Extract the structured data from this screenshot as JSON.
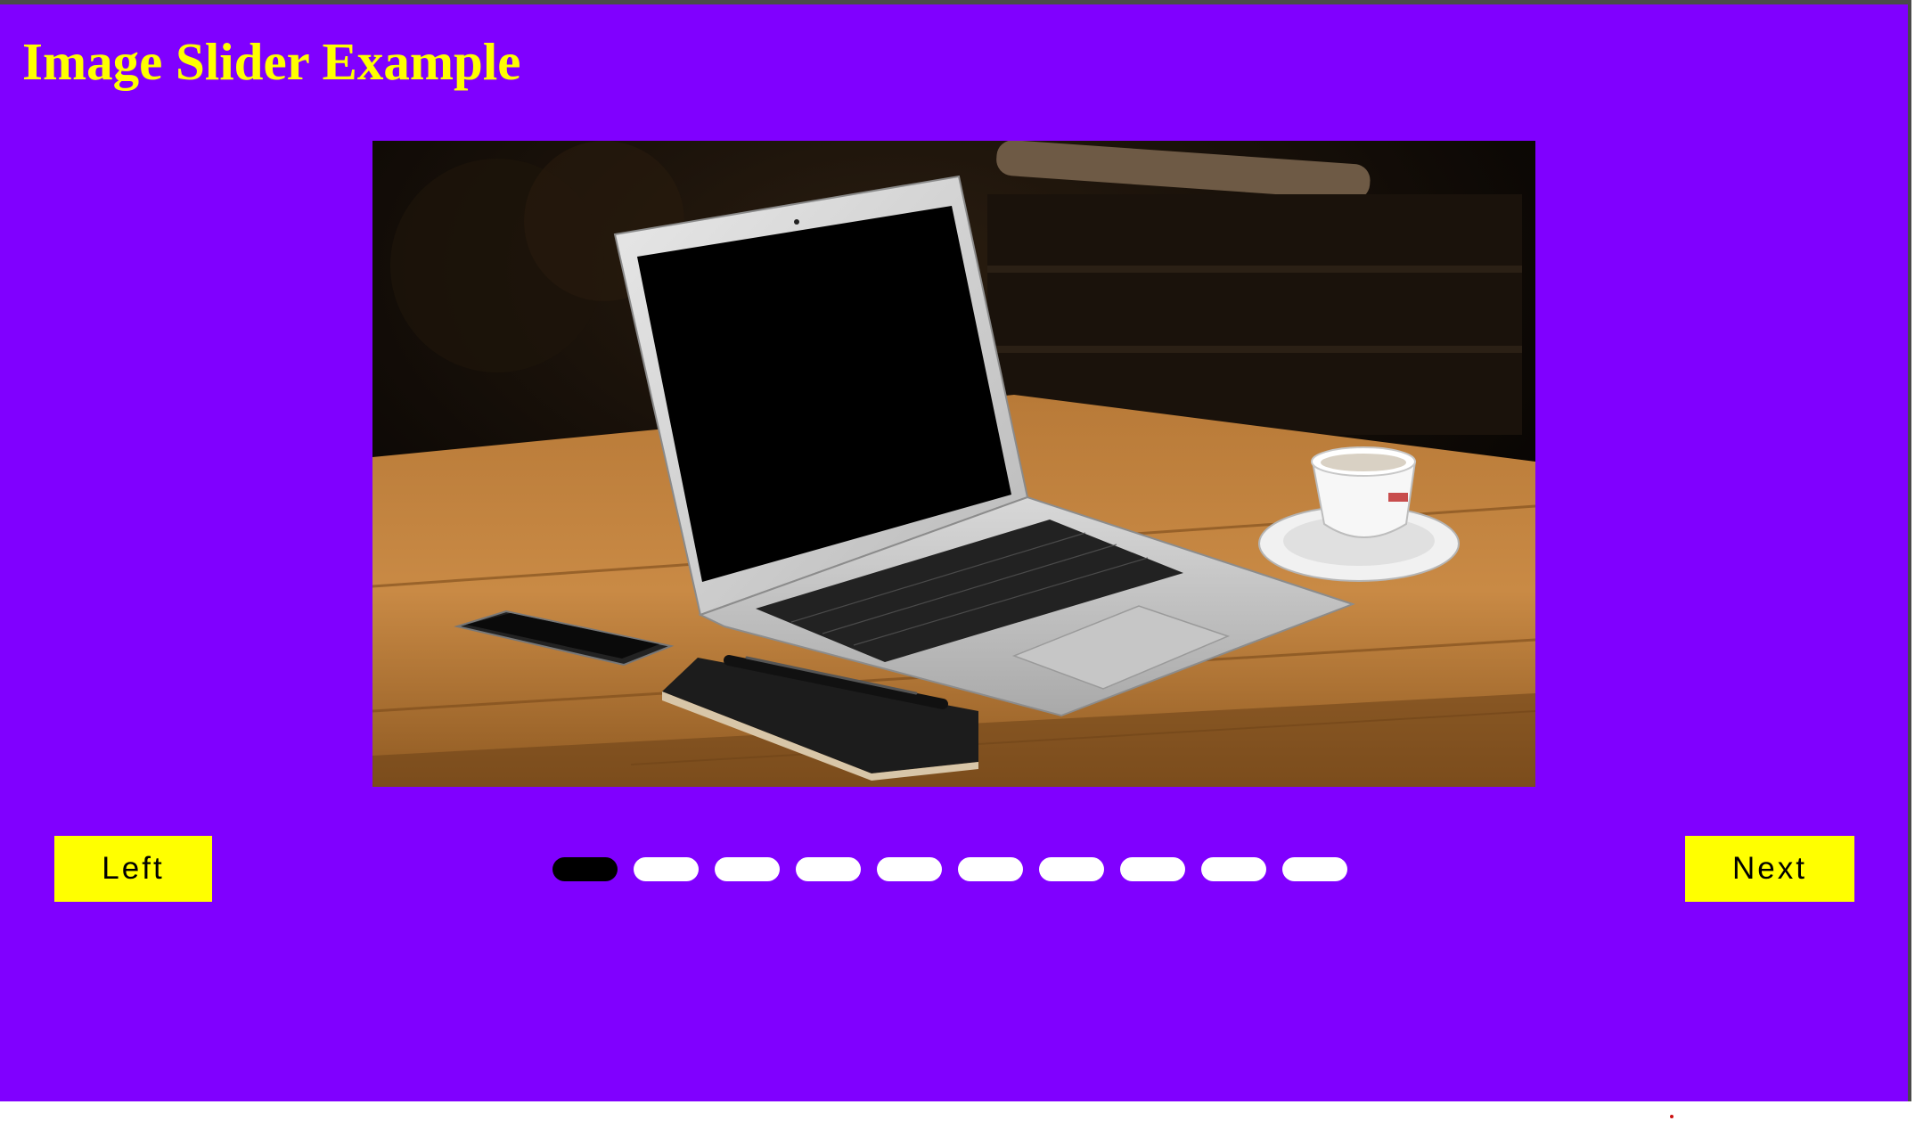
{
  "page": {
    "title": "Image Slider Example"
  },
  "slider": {
    "current_slide": 1,
    "total_slides": 10,
    "image_description": "laptop-on-wooden-table",
    "left_button_label": "Left",
    "next_button_label": "Next"
  },
  "colors": {
    "background": "#8000ff",
    "title": "#ffff00",
    "button": "#ffff00",
    "dot_inactive": "#ffffff",
    "dot_active": "#000000"
  }
}
